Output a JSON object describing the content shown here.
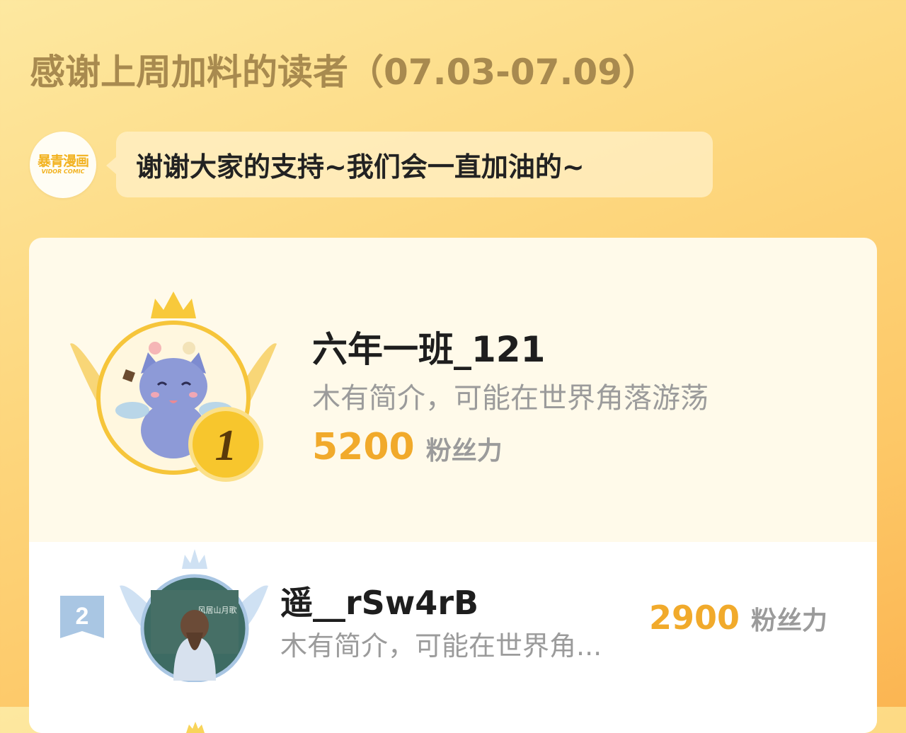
{
  "header": {
    "title": "感谢上周加料的读者（07.03-07.09）"
  },
  "logo": {
    "brand": "暴青漫画",
    "brand_sub": "VIDOR COMIC"
  },
  "message": {
    "text": "谢谢大家的支持~我们会一直加油的~"
  },
  "ranking": [
    {
      "rank": "1",
      "name": "六年一班_121",
      "bio": "木有简介，可能在世界角落游荡",
      "score": "5200",
      "unit": "粉丝力"
    },
    {
      "rank": "2",
      "name": "遥__rSw4rB",
      "bio": "木有简介，可能在世界角...",
      "score": "2900",
      "unit": "粉丝力"
    }
  ],
  "avatar_text": {
    "board": "风居山月歌"
  },
  "colors": {
    "accent": "#f1aa2b",
    "title": "#a88a4f",
    "muted": "#9b9b9b"
  }
}
